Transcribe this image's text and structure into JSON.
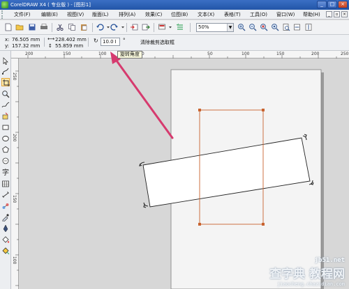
{
  "app": {
    "window_title": "CorelDRAW X4 ( 专业版 ) - [图形1]"
  },
  "menu": {
    "items": [
      {
        "label": "文件(F)",
        "id": "file"
      },
      {
        "label": "编辑(E)",
        "id": "edit"
      },
      {
        "label": "视图(V)",
        "id": "view"
      },
      {
        "label": "版面(L)",
        "id": "layout"
      },
      {
        "label": "排列(A)",
        "id": "arrange"
      },
      {
        "label": "效果(C)",
        "id": "effects"
      },
      {
        "label": "位图(B)",
        "id": "bitmaps"
      },
      {
        "label": "文本(X)",
        "id": "text"
      },
      {
        "label": "表格(T)",
        "id": "table"
      },
      {
        "label": "工具(O)",
        "id": "tools"
      },
      {
        "label": "窗口(W)",
        "id": "window"
      },
      {
        "label": "帮助(H)",
        "id": "help"
      }
    ]
  },
  "toolbar": {
    "zoom_value": "50%"
  },
  "property_bar": {
    "x_label": "x:",
    "x_value": "76.505 mm",
    "y_label": "y:",
    "y_value": "157.32 mm",
    "width_value": "228.402 mm",
    "height_value": "55.859 mm",
    "rotation_value": "10.0",
    "degree_symbol": "°",
    "clear_crop_label": "清除裁剪选取框"
  },
  "rulers": {
    "horizontal_numbers": [
      "200",
      "150",
      "100",
      "50"
    ],
    "horizontal_trailing": [
      "50",
      "100",
      "150",
      "200",
      "250"
    ],
    "vertical_numbers": [
      "250",
      "200",
      "150",
      "100"
    ]
  },
  "tooltip": {
    "text": "旋转角度"
  },
  "watermark": {
    "brand": "查字典 教程网",
    "site_top": "jb51.net",
    "site_url": "jiaocheng.chazidian.com"
  },
  "colors": {
    "title_bar": "#2a5fb4",
    "crop_frame": "#c8632f",
    "arrow": "#d63a6e",
    "canvas": "#d7d7d7",
    "page": "#ffffff"
  }
}
